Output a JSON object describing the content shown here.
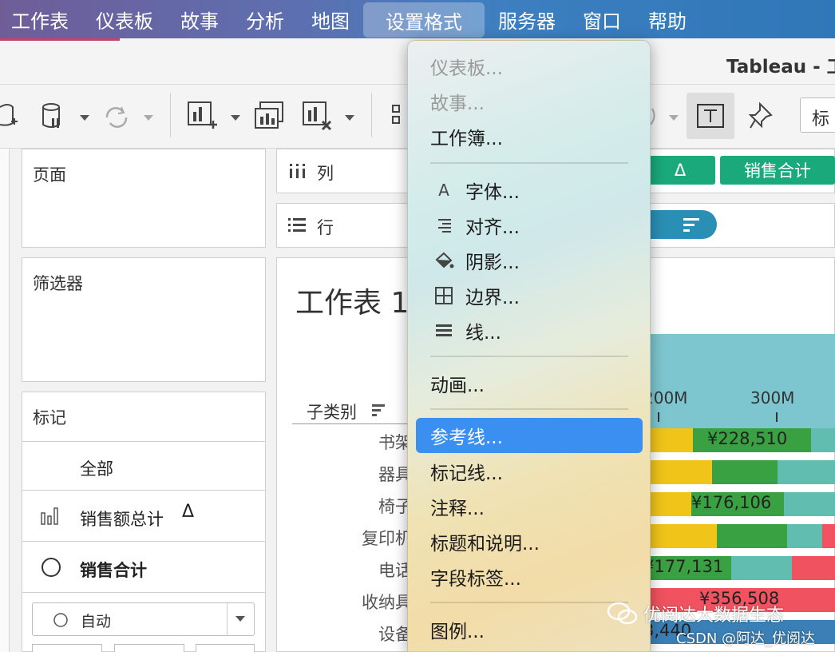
{
  "menubar": {
    "items": [
      "工作表",
      "仪表板",
      "故事",
      "分析",
      "地图",
      "设置格式",
      "服务器",
      "窗口",
      "帮助"
    ],
    "active_index": 5
  },
  "window": {
    "title": "Tableau - 工"
  },
  "toolbar": {
    "label_box": "标"
  },
  "cards": {
    "pages": "页面",
    "filters": "筛选器",
    "marks": "标记",
    "marks_all": "全部",
    "marks_sum": "销售额总计",
    "marks_sum_delta": "Δ",
    "marks_total": "销售合计",
    "mark_type": "自动"
  },
  "shelves": {
    "columns": "列",
    "rows": "行",
    "pill_delta": "Δ",
    "pill_total": "销售合计"
  },
  "view": {
    "sheet_title": "工作表 1",
    "header": "子类别"
  },
  "chart_data": {
    "type": "bar",
    "x_ticks": [
      "200M",
      "300M"
    ],
    "categories": [
      "书架",
      "器具",
      "椅子",
      "复印机",
      "电话",
      "收纳具",
      "设备"
    ],
    "data_labels": [
      "¥228,510",
      "",
      "¥176,106",
      "",
      "¥177,131",
      "¥356,508",
      "3,440"
    ]
  },
  "menu": {
    "items": [
      {
        "label": "仪表板...",
        "disabled": true
      },
      {
        "label": "故事...",
        "disabled": true
      },
      {
        "label": "工作簿..."
      },
      {
        "label": "字体...",
        "icon": "font-icon"
      },
      {
        "label": "对齐...",
        "icon": "align-icon"
      },
      {
        "label": "阴影...",
        "icon": "shading-icon"
      },
      {
        "label": "边界...",
        "icon": "borders-icon"
      },
      {
        "label": "线...",
        "icon": "lines-icon"
      },
      {
        "label": "动画..."
      },
      {
        "label": "参考线...",
        "selected": true
      },
      {
        "label": "标记线..."
      },
      {
        "label": "注释..."
      },
      {
        "label": "标题和说明..."
      },
      {
        "label": "字段标签..."
      },
      {
        "label": "图例..."
      }
    ]
  },
  "watermark": {
    "line1": "优阅达大数据生态",
    "line2": "CSDN @阿达_优阅达"
  },
  "colors": {
    "accent": "#3a8ff0",
    "green_pill": "#1aa97b",
    "blue_pill": "#2a8fb5",
    "yellow": "#f0c419",
    "green": "#3aa142",
    "teal": "#62bdb1",
    "red": "#f0525f"
  }
}
